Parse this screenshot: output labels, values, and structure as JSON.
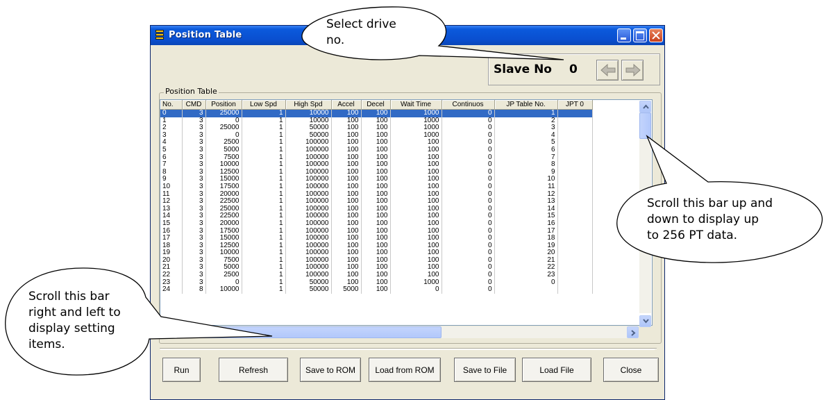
{
  "window": {
    "title": "Position Table"
  },
  "slave": {
    "label": "Slave No",
    "value": "0"
  },
  "group": {
    "label": "Position Table"
  },
  "table": {
    "columns": [
      "No.",
      "CMD",
      "Position",
      "Low Spd",
      "High Spd",
      "Accel",
      "Decel",
      "Wait Time",
      "Continuos",
      "JP Table No.",
      "JPT 0"
    ],
    "selected_row": 0,
    "rows": [
      [
        "0",
        "3",
        "25000",
        "1",
        "10000",
        "100",
        "100",
        "1000",
        "0",
        "1",
        ""
      ],
      [
        "1",
        "3",
        "0",
        "1",
        "10000",
        "100",
        "100",
        "1000",
        "0",
        "2",
        ""
      ],
      [
        "2",
        "3",
        "25000",
        "1",
        "50000",
        "100",
        "100",
        "1000",
        "0",
        "3",
        ""
      ],
      [
        "3",
        "3",
        "0",
        "1",
        "50000",
        "100",
        "100",
        "1000",
        "0",
        "4",
        ""
      ],
      [
        "4",
        "3",
        "2500",
        "1",
        "100000",
        "100",
        "100",
        "100",
        "0",
        "5",
        ""
      ],
      [
        "5",
        "3",
        "5000",
        "1",
        "100000",
        "100",
        "100",
        "100",
        "0",
        "6",
        ""
      ],
      [
        "6",
        "3",
        "7500",
        "1",
        "100000",
        "100",
        "100",
        "100",
        "0",
        "7",
        ""
      ],
      [
        "7",
        "3",
        "10000",
        "1",
        "100000",
        "100",
        "100",
        "100",
        "0",
        "8",
        ""
      ],
      [
        "8",
        "3",
        "12500",
        "1",
        "100000",
        "100",
        "100",
        "100",
        "0",
        "9",
        ""
      ],
      [
        "9",
        "3",
        "15000",
        "1",
        "100000",
        "100",
        "100",
        "100",
        "0",
        "10",
        ""
      ],
      [
        "10",
        "3",
        "17500",
        "1",
        "100000",
        "100",
        "100",
        "100",
        "0",
        "11",
        ""
      ],
      [
        "11",
        "3",
        "20000",
        "1",
        "100000",
        "100",
        "100",
        "100",
        "0",
        "12",
        ""
      ],
      [
        "12",
        "3",
        "22500",
        "1",
        "100000",
        "100",
        "100",
        "100",
        "0",
        "13",
        ""
      ],
      [
        "13",
        "3",
        "25000",
        "1",
        "100000",
        "100",
        "100",
        "100",
        "0",
        "14",
        ""
      ],
      [
        "14",
        "3",
        "22500",
        "1",
        "100000",
        "100",
        "100",
        "100",
        "0",
        "15",
        ""
      ],
      [
        "15",
        "3",
        "20000",
        "1",
        "100000",
        "100",
        "100",
        "100",
        "0",
        "16",
        ""
      ],
      [
        "16",
        "3",
        "17500",
        "1",
        "100000",
        "100",
        "100",
        "100",
        "0",
        "17",
        ""
      ],
      [
        "17",
        "3",
        "15000",
        "1",
        "100000",
        "100",
        "100",
        "100",
        "0",
        "18",
        ""
      ],
      [
        "18",
        "3",
        "12500",
        "1",
        "100000",
        "100",
        "100",
        "100",
        "0",
        "19",
        ""
      ],
      [
        "19",
        "3",
        "10000",
        "1",
        "100000",
        "100",
        "100",
        "100",
        "0",
        "20",
        ""
      ],
      [
        "20",
        "3",
        "7500",
        "1",
        "100000",
        "100",
        "100",
        "100",
        "0",
        "21",
        ""
      ],
      [
        "21",
        "3",
        "5000",
        "1",
        "100000",
        "100",
        "100",
        "100",
        "0",
        "22",
        ""
      ],
      [
        "22",
        "3",
        "2500",
        "1",
        "100000",
        "100",
        "100",
        "100",
        "0",
        "23",
        ""
      ],
      [
        "23",
        "3",
        "0",
        "1",
        "50000",
        "100",
        "100",
        "1000",
        "0",
        "0",
        ""
      ],
      [
        "24",
        "8",
        "10000",
        "1",
        "50000",
        "5000",
        "100",
        "0",
        "0",
        "",
        ""
      ]
    ]
  },
  "buttons": {
    "run": "Run",
    "refresh": "Refresh",
    "save_rom": "Save to ROM",
    "load_rom": "Load from ROM",
    "save_file": "Save to File",
    "load_file": "Load File",
    "close": "Close"
  },
  "callouts": {
    "select_drive": [
      "Select drive",
      "no."
    ],
    "scroll_vertical": [
      "Scroll this bar up and",
      "down to display up",
      "to 256 PT data."
    ],
    "scroll_horizontal": [
      "Scroll this bar",
      "right and left to",
      "display setting",
      "items."
    ]
  }
}
